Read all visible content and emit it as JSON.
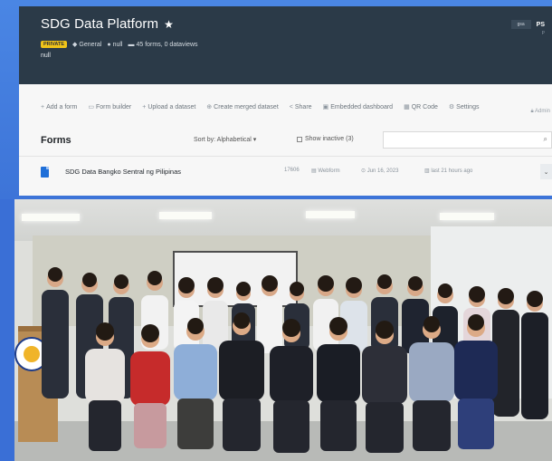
{
  "app": {
    "title": "SDG Data Platform",
    "star": "★",
    "badge": "PRIVATE",
    "category": "General",
    "location": "null",
    "forms_count": "45 forms, 0 dataviews",
    "description": "null",
    "user_name": "PS",
    "user_sub": "P",
    "avatar_alt": "gsa"
  },
  "toolbar": {
    "items": [
      {
        "icon": "+",
        "label": "Add a form"
      },
      {
        "icon": "▭",
        "label": "Form builder"
      },
      {
        "icon": "+",
        "label": "Upload a dataset"
      },
      {
        "icon": "⊕",
        "label": "Create merged dataset"
      },
      {
        "icon": "<",
        "label": "Share"
      },
      {
        "icon": "▣",
        "label": "Embedded dashboard"
      },
      {
        "icon": "▦",
        "label": "QR Code"
      },
      {
        "icon": "⚙",
        "label": "Settings"
      }
    ],
    "admin": "Admin"
  },
  "forms": {
    "title": "Forms",
    "sort_label": "Sort by: Alphabetical ▾",
    "show_inactive": "Show inactive (3)",
    "search_placeholder": "",
    "rows": [
      {
        "name": "SDG Data Bangko Sentral ng Pilipinas",
        "id": "17606",
        "type": "Webform",
        "date": "Jun 16, 2023",
        "updated": "last 21 hours ago"
      }
    ]
  },
  "colors": {
    "header_bg": "#2b3a48",
    "accent": "#1f6fd8",
    "badge": "#f0c419",
    "frame": "#3d74d8"
  }
}
